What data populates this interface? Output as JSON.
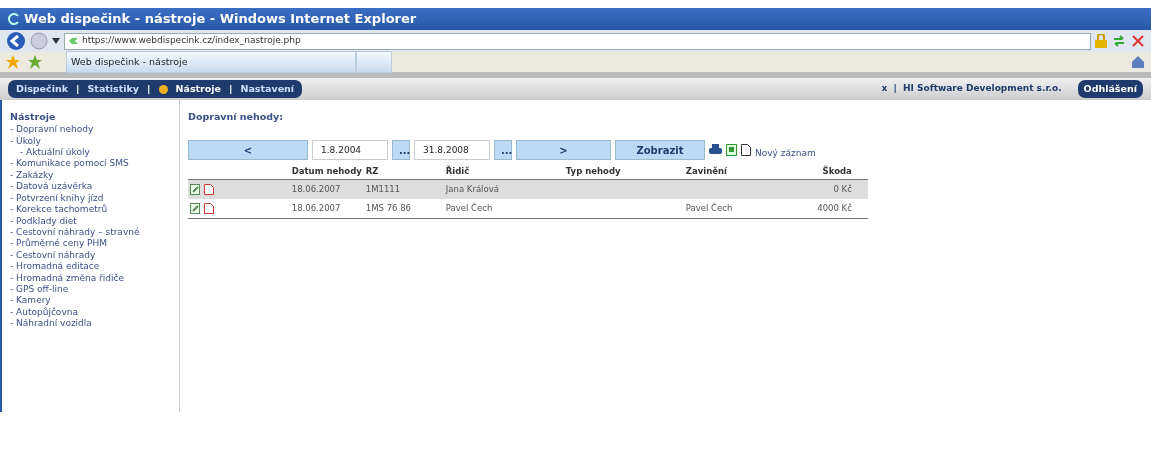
{
  "window": {
    "title": "Web dispečink - nástroje - Windows Internet Explorer"
  },
  "address_bar": {
    "url": "https://www.webdispecink.cz/index_nastroje.php"
  },
  "browser_tabs": [
    {
      "label": "Web dispečink - nástroje",
      "selected": true
    }
  ],
  "nav": {
    "items": [
      {
        "label": "Dispečink",
        "selected": false
      },
      {
        "label": "Statistiky",
        "selected": false
      },
      {
        "label": "Nástroje",
        "selected": true
      },
      {
        "label": "Nastavení",
        "selected": false
      }
    ],
    "user": "x",
    "separator": "|",
    "company": "HI Software Development s.r.o.",
    "logout": "Odhlášení"
  },
  "sidebar": {
    "title": "Nástroje",
    "items": [
      {
        "label": "- Dopravní nehody"
      },
      {
        "label": "- Úkoly",
        "children": [
          {
            "label": "- Aktuální úkoly"
          }
        ]
      },
      {
        "label": "- Komunikace pomocí SMS"
      },
      {
        "label": "- Zakázky"
      },
      {
        "label": "- Datová uzávěrka"
      },
      {
        "label": "- Potvrzení knihy jízd"
      },
      {
        "label": "- Korekce tachometrů"
      },
      {
        "label": "- Podklady diet"
      },
      {
        "label": "- Cestovní náhrady – stravné"
      },
      {
        "label": "- Průměrné ceny PHM"
      },
      {
        "label": "- Cestovní náhrady"
      },
      {
        "label": "- Hromadná editace"
      },
      {
        "label": "- Hromadná změna řidiče"
      },
      {
        "label": "- GPS off-line"
      },
      {
        "label": "- Kamery"
      },
      {
        "label": "- Autopůjčovna"
      },
      {
        "label": "- Náhradní vozidla"
      }
    ]
  },
  "content": {
    "heading": "Dopravní nehody:",
    "filter": {
      "prev": "<",
      "date_from": "1.8.2004",
      "picker": "...",
      "date_to": "31.8.2008",
      "next": ">",
      "show": "Zobrazit",
      "new_record": "Nový záznam"
    },
    "table": {
      "columns": [
        "Datum nehody",
        "RZ",
        "Řidič",
        "Typ nehody",
        "Zavinění",
        "Škoda"
      ],
      "rows": [
        {
          "selected": true,
          "cells": [
            "18.06.2007",
            "1M1111",
            "Jana Králová",
            "",
            "",
            "0 Kč"
          ]
        },
        {
          "selected": false,
          "cells": [
            "18.06.2007",
            "1MS 76 86",
            "Pavel Čech",
            "",
            "Pavel Čech",
            "4000 Kč"
          ]
        }
      ]
    }
  }
}
